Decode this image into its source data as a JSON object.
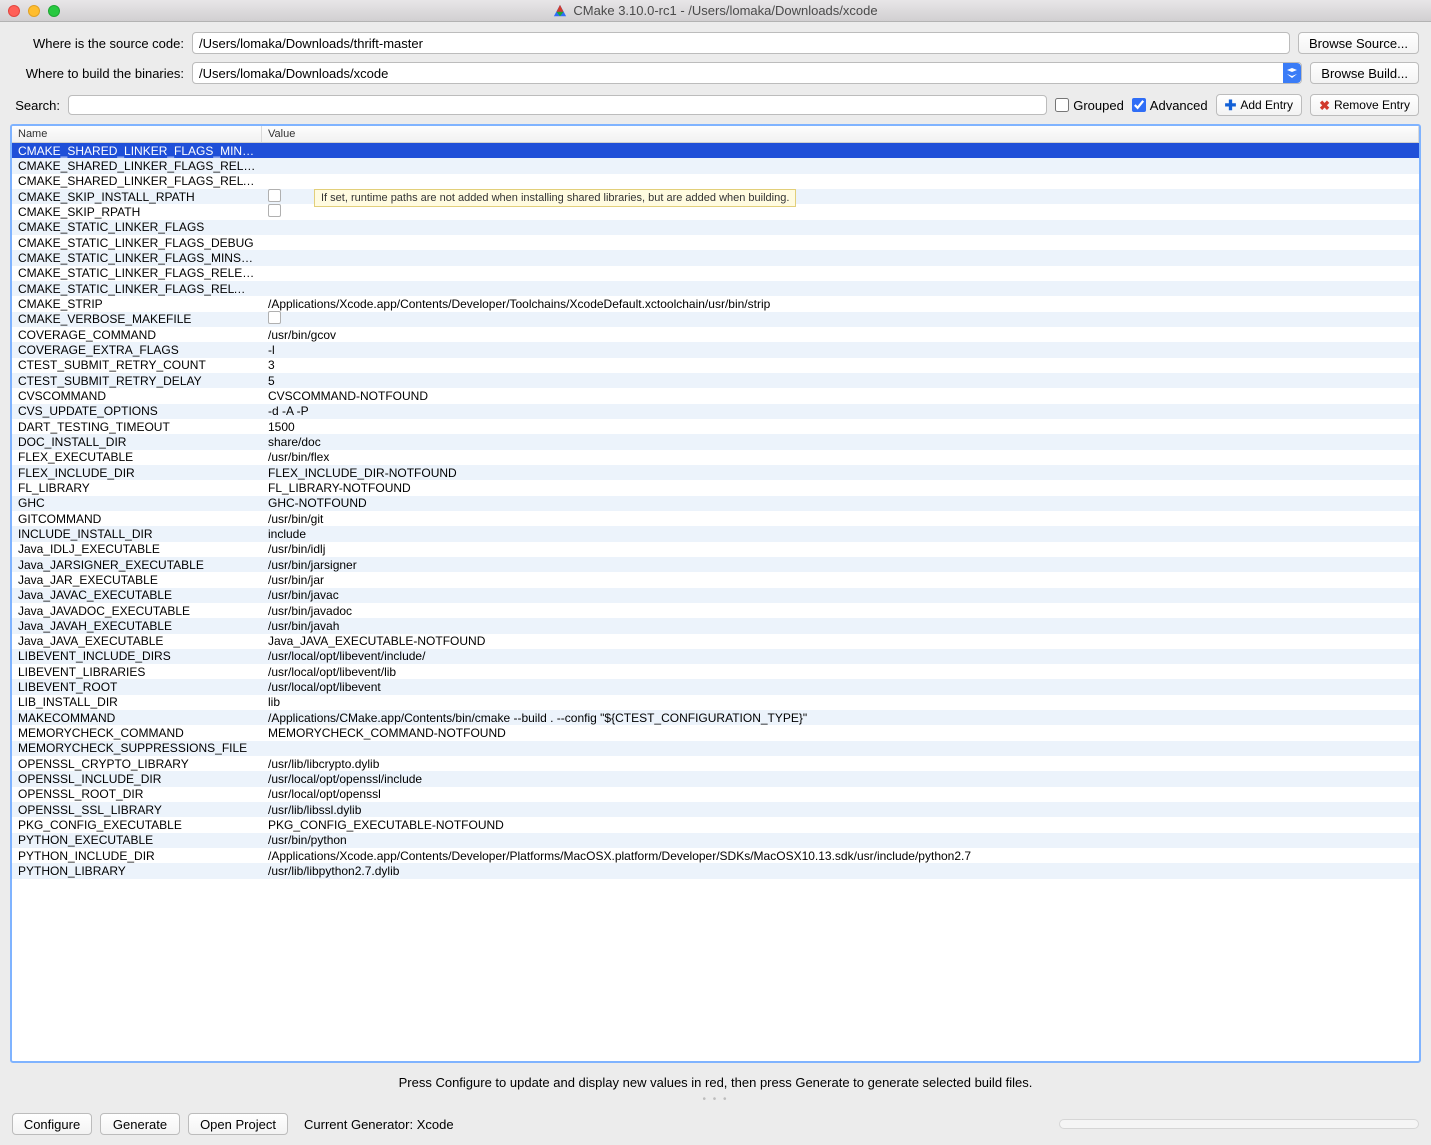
{
  "window": {
    "title": "CMake 3.10.0-rc1 - /Users/lomaka/Downloads/xcode"
  },
  "form": {
    "source_label": "Where is the source code:",
    "source_value": "/Users/lomaka/Downloads/thrift-master",
    "browse_source_label": "Browse Source...",
    "build_label": "Where to build the binaries:",
    "build_value": "/Users/lomaka/Downloads/xcode",
    "browse_build_label": "Browse Build..."
  },
  "search": {
    "label": "Search:",
    "value": "",
    "grouped_label": "Grouped",
    "advanced_label": "Advanced",
    "add_entry_label": "Add Entry",
    "remove_entry_label": "Remove Entry"
  },
  "table": {
    "header_name": "Name",
    "header_value": "Value",
    "tooltip": "If set, runtime paths are not added when installing shared libraries, but are added when building.",
    "rows": [
      {
        "name": "CMAKE_SHARED_LINKER_FLAGS_MINSIZEREL",
        "value": "",
        "type": "text",
        "selected": true
      },
      {
        "name": "CMAKE_SHARED_LINKER_FLAGS_RELEASE",
        "value": "",
        "type": "text"
      },
      {
        "name": "CMAKE_SHARED_LINKER_FLAGS_RELWITHD...",
        "value": "",
        "type": "text"
      },
      {
        "name": "CMAKE_SKIP_INSTALL_RPATH",
        "value": "",
        "type": "bool"
      },
      {
        "name": "CMAKE_SKIP_RPATH",
        "value": "",
        "type": "bool"
      },
      {
        "name": "CMAKE_STATIC_LINKER_FLAGS",
        "value": "",
        "type": "text"
      },
      {
        "name": "CMAKE_STATIC_LINKER_FLAGS_DEBUG",
        "value": "",
        "type": "text"
      },
      {
        "name": "CMAKE_STATIC_LINKER_FLAGS_MINSIZEREL",
        "value": "",
        "type": "text"
      },
      {
        "name": "CMAKE_STATIC_LINKER_FLAGS_RELEASE",
        "value": "",
        "type": "text"
      },
      {
        "name": "CMAKE_STATIC_LINKER_FLAGS_RELWITHD...",
        "value": "",
        "type": "text"
      },
      {
        "name": "CMAKE_STRIP",
        "value": "/Applications/Xcode.app/Contents/Developer/Toolchains/XcodeDefault.xctoolchain/usr/bin/strip",
        "type": "text"
      },
      {
        "name": "CMAKE_VERBOSE_MAKEFILE",
        "value": "",
        "type": "bool"
      },
      {
        "name": "COVERAGE_COMMAND",
        "value": "/usr/bin/gcov",
        "type": "text"
      },
      {
        "name": "COVERAGE_EXTRA_FLAGS",
        "value": "-l",
        "type": "text"
      },
      {
        "name": "CTEST_SUBMIT_RETRY_COUNT",
        "value": "3",
        "type": "text"
      },
      {
        "name": "CTEST_SUBMIT_RETRY_DELAY",
        "value": "5",
        "type": "text"
      },
      {
        "name": "CVSCOMMAND",
        "value": "CVSCOMMAND-NOTFOUND",
        "type": "text"
      },
      {
        "name": "CVS_UPDATE_OPTIONS",
        "value": "-d -A -P",
        "type": "text"
      },
      {
        "name": "DART_TESTING_TIMEOUT",
        "value": "1500",
        "type": "text"
      },
      {
        "name": "DOC_INSTALL_DIR",
        "value": "share/doc",
        "type": "text"
      },
      {
        "name": "FLEX_EXECUTABLE",
        "value": "/usr/bin/flex",
        "type": "text"
      },
      {
        "name": "FLEX_INCLUDE_DIR",
        "value": "FLEX_INCLUDE_DIR-NOTFOUND",
        "type": "text"
      },
      {
        "name": "FL_LIBRARY",
        "value": "FL_LIBRARY-NOTFOUND",
        "type": "text"
      },
      {
        "name": "GHC",
        "value": "GHC-NOTFOUND",
        "type": "text"
      },
      {
        "name": "GITCOMMAND",
        "value": "/usr/bin/git",
        "type": "text"
      },
      {
        "name": "INCLUDE_INSTALL_DIR",
        "value": "include",
        "type": "text"
      },
      {
        "name": "Java_IDLJ_EXECUTABLE",
        "value": "/usr/bin/idlj",
        "type": "text"
      },
      {
        "name": "Java_JARSIGNER_EXECUTABLE",
        "value": "/usr/bin/jarsigner",
        "type": "text"
      },
      {
        "name": "Java_JAR_EXECUTABLE",
        "value": "/usr/bin/jar",
        "type": "text"
      },
      {
        "name": "Java_JAVAC_EXECUTABLE",
        "value": "/usr/bin/javac",
        "type": "text"
      },
      {
        "name": "Java_JAVADOC_EXECUTABLE",
        "value": "/usr/bin/javadoc",
        "type": "text"
      },
      {
        "name": "Java_JAVAH_EXECUTABLE",
        "value": "/usr/bin/javah",
        "type": "text"
      },
      {
        "name": "Java_JAVA_EXECUTABLE",
        "value": "Java_JAVA_EXECUTABLE-NOTFOUND",
        "type": "text"
      },
      {
        "name": "LIBEVENT_INCLUDE_DIRS",
        "value": "/usr/local/opt/libevent/include/",
        "type": "text"
      },
      {
        "name": "LIBEVENT_LIBRARIES",
        "value": "/usr/local/opt/libevent/lib",
        "type": "text"
      },
      {
        "name": "LIBEVENT_ROOT",
        "value": "/usr/local/opt/libevent",
        "type": "text"
      },
      {
        "name": "LIB_INSTALL_DIR",
        "value": "lib",
        "type": "text"
      },
      {
        "name": "MAKECOMMAND",
        "value": "/Applications/CMake.app/Contents/bin/cmake --build . --config \"${CTEST_CONFIGURATION_TYPE}\"",
        "type": "text"
      },
      {
        "name": "MEMORYCHECK_COMMAND",
        "value": "MEMORYCHECK_COMMAND-NOTFOUND",
        "type": "text"
      },
      {
        "name": "MEMORYCHECK_SUPPRESSIONS_FILE",
        "value": "",
        "type": "text"
      },
      {
        "name": "OPENSSL_CRYPTO_LIBRARY",
        "value": "/usr/lib/libcrypto.dylib",
        "type": "text"
      },
      {
        "name": "OPENSSL_INCLUDE_DIR",
        "value": "/usr/local/opt/openssl/include",
        "type": "text"
      },
      {
        "name": "OPENSSL_ROOT_DIR",
        "value": "/usr/local/opt/openssl",
        "type": "text"
      },
      {
        "name": "OPENSSL_SSL_LIBRARY",
        "value": "/usr/lib/libssl.dylib",
        "type": "text"
      },
      {
        "name": "PKG_CONFIG_EXECUTABLE",
        "value": "PKG_CONFIG_EXECUTABLE-NOTFOUND",
        "type": "text"
      },
      {
        "name": "PYTHON_EXECUTABLE",
        "value": "/usr/bin/python",
        "type": "text"
      },
      {
        "name": "PYTHON_INCLUDE_DIR",
        "value": "/Applications/Xcode.app/Contents/Developer/Platforms/MacOSX.platform/Developer/SDKs/MacOSX10.13.sdk/usr/include/python2.7",
        "type": "text"
      },
      {
        "name": "PYTHON_LIBRARY",
        "value": "/usr/lib/libpython2.7.dylib",
        "type": "text"
      }
    ]
  },
  "hint": "Press Configure to update and display new values in red, then press Generate to generate selected build files.",
  "bottom": {
    "configure_label": "Configure",
    "generate_label": "Generate",
    "open_project_label": "Open Project",
    "generator_label": "Current Generator: Xcode"
  }
}
